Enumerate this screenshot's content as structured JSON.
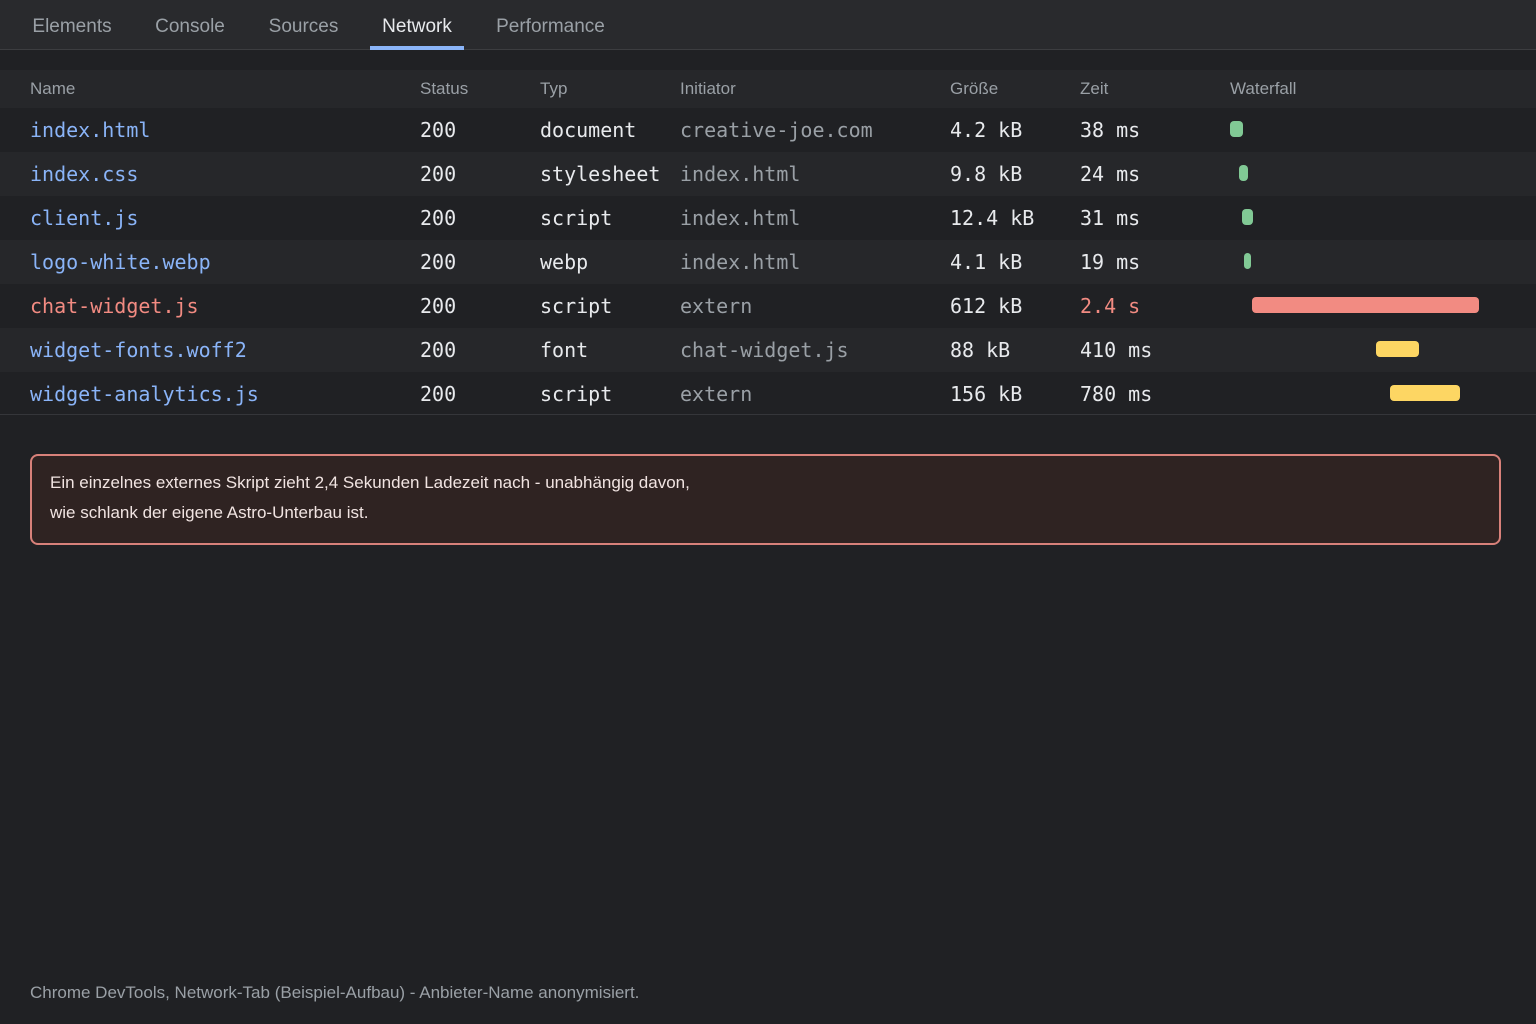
{
  "tabs": [
    {
      "label": "Elements",
      "active": false
    },
    {
      "label": "Console",
      "active": false
    },
    {
      "label": "Sources",
      "active": false
    },
    {
      "label": "Network",
      "active": true
    },
    {
      "label": "Performance",
      "active": false
    }
  ],
  "columns": {
    "name": "Name",
    "status": "Status",
    "type": "Typ",
    "initiator": "Initiator",
    "size": "Größe",
    "time": "Zeit",
    "waterfall": "Waterfall"
  },
  "requests": [
    {
      "name": "index.html",
      "status": "200",
      "type": "document",
      "initiator": "creative-joe.com",
      "size": "4.2 kB",
      "time": "38 ms",
      "slow": false
    },
    {
      "name": "index.css",
      "status": "200",
      "type": "stylesheet",
      "initiator": "index.html",
      "size": "9.8 kB",
      "time": "24 ms",
      "slow": false
    },
    {
      "name": "client.js",
      "status": "200",
      "type": "script",
      "initiator": "index.html",
      "size": "12.4 kB",
      "time": "31 ms",
      "slow": false
    },
    {
      "name": "logo-white.webp",
      "status": "200",
      "type": "webp",
      "initiator": "index.html",
      "size": "4.1 kB",
      "time": "19 ms",
      "slow": false
    },
    {
      "name": "chat-widget.js",
      "status": "200",
      "type": "script",
      "initiator": "extern",
      "size": "612 kB",
      "time": "2.4 s",
      "slow": true
    },
    {
      "name": "widget-fonts.woff2",
      "status": "200",
      "type": "font",
      "initiator": "chat-widget.js",
      "size": "88 kB",
      "time": "410 ms",
      "slow": false
    },
    {
      "name": "widget-analytics.js",
      "status": "200",
      "type": "script",
      "initiator": "extern",
      "size": "156 kB",
      "time": "780 ms",
      "slow": false
    }
  ],
  "colors": {
    "fast": "#81c995",
    "slow": "#f28b82",
    "medium": "#fdd663",
    "accent": "#8ab4f8"
  },
  "callout": {
    "text": "Ein einzelnes externes Skript zieht 2,4 Sekunden Ladezeit nach - unabhängig davon, wie schlank der eigene Astro-Unterbau ist."
  },
  "footer": {
    "caption": "Chrome DevTools, Network-Tab (Beispiel-Aufbau) - Anbieter-Name anonymisiert."
  }
}
